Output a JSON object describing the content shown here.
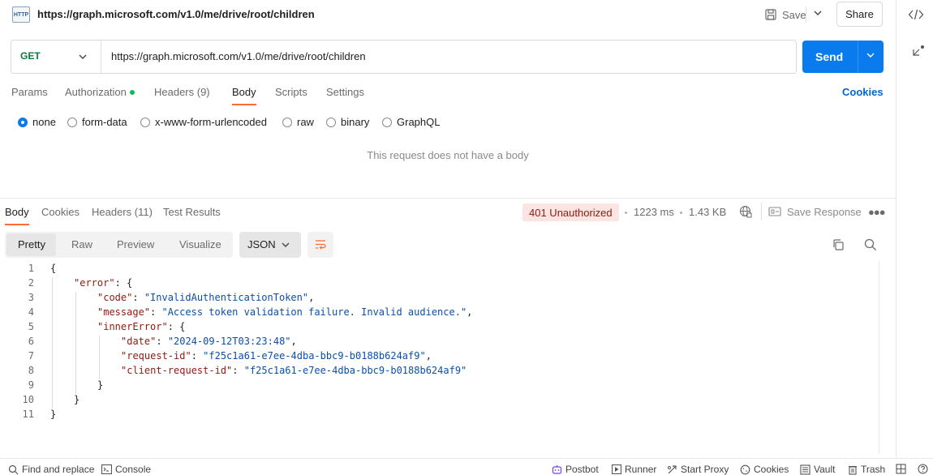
{
  "request": {
    "icon_text": "HTTP",
    "title": "https://graph.microsoft.com/v1.0/me/drive/root/children",
    "save_label": "Save",
    "share_label": "Share",
    "method": "GET",
    "url": "https://graph.microsoft.com/v1.0/me/drive/root/children",
    "send_label": "Send",
    "tabs": [
      "Params",
      "Authorization",
      "Headers (9)",
      "Body",
      "Scripts",
      "Settings"
    ],
    "active_tab": "Body",
    "cookies_label": "Cookies",
    "body_types": [
      "none",
      "form-data",
      "x-www-form-urlencoded",
      "raw",
      "binary",
      "GraphQL"
    ],
    "selected_body_type": "none",
    "no_body_text": "This request does not have a body"
  },
  "response": {
    "tabs": [
      "Body",
      "Cookies",
      "Headers (11)",
      "Test Results"
    ],
    "active_tab": "Body",
    "status": "401 Unauthorized",
    "time": "1223 ms",
    "size": "1.43 KB",
    "save_response_label": "Save Response",
    "view_modes": [
      "Pretty",
      "Raw",
      "Preview",
      "Visualize"
    ],
    "active_view_mode": "Pretty",
    "format": "JSON",
    "line_numbers": [
      "1",
      "2",
      "3",
      "4",
      "5",
      "6",
      "7",
      "8",
      "9",
      "10",
      "11"
    ],
    "code": {
      "l2_key": "\"error\"",
      "l3_key": "\"code\"",
      "l3_val": "\"InvalidAuthenticationToken\"",
      "l4_key": "\"message\"",
      "l4_val": "\"Access token validation failure. Invalid audience.\"",
      "l5_key": "\"innerError\"",
      "l6_key": "\"date\"",
      "l6_val": "\"2024-09-12T03:23:48\"",
      "l7_key": "\"request-id\"",
      "l7_val": "\"f25c1a61-e7ee-4dba-bbc9-b0188b624af9\"",
      "l8_key": "\"client-request-id\"",
      "l8_val": "\"f25c1a61-e7ee-4dba-bbc9-b0188b624af9\""
    }
  },
  "statusbar": {
    "left": [
      "Find and replace",
      "Console"
    ],
    "right": [
      "Postbot",
      "Runner",
      "Start Proxy",
      "Cookies",
      "Vault",
      "Trash"
    ]
  },
  "colors": {
    "accent": "#ff6c37",
    "send": "#097bed",
    "method_get": "#0b7a3e",
    "status_error_bg": "#fbe4e2",
    "status_error_text": "#8e1a10"
  }
}
